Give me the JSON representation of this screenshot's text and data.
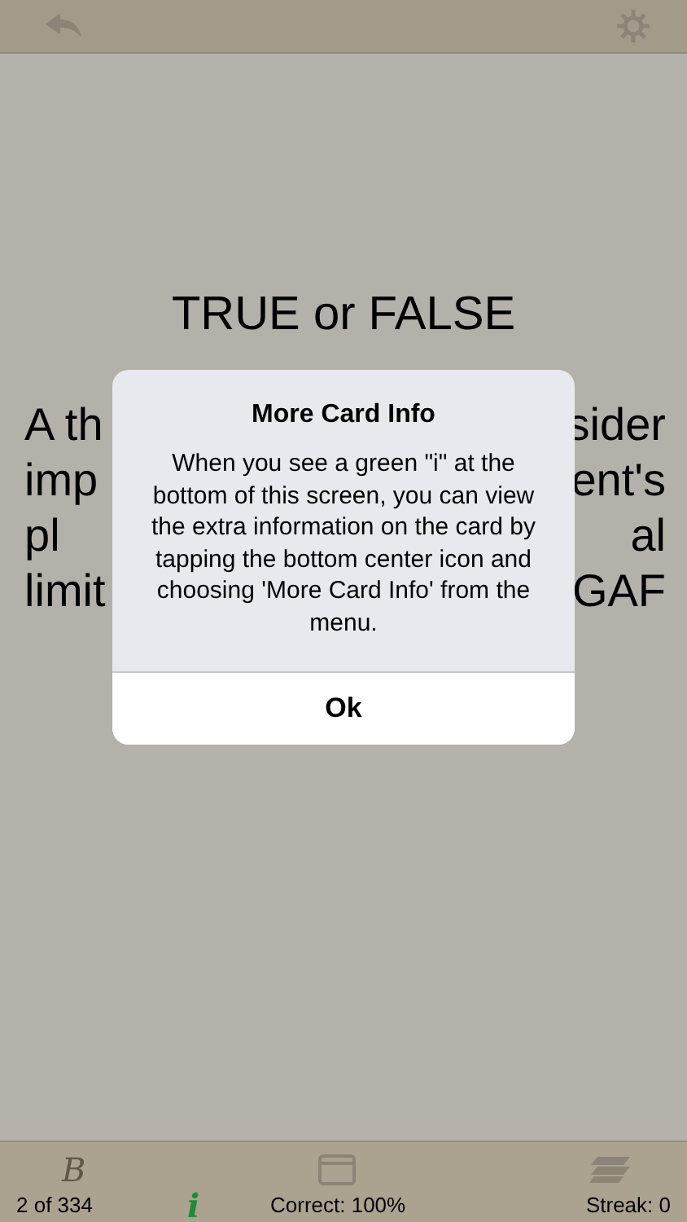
{
  "card": {
    "heading": "TRUE or FALSE",
    "lines": [
      {
        "left": "A th",
        "right": "sider"
      },
      {
        "left": "imp",
        "right": "ent's"
      },
      {
        "left": "pl",
        "right": "al"
      },
      {
        "left": "limit",
        "right": "GAF"
      }
    ]
  },
  "dialog": {
    "title": "More Card Info",
    "message": "When you see a green \"i\" at the bottom of this screen, you can view the extra information on the card by tapping the bottom center icon and choosing 'More Card Info' from the menu.",
    "button": "Ok"
  },
  "bottom_bar": {
    "bookmark_glyph": "B",
    "info_glyph": "i",
    "position": "2 of 334",
    "correct": "Correct: 100%",
    "streak": "Streak: 0"
  }
}
